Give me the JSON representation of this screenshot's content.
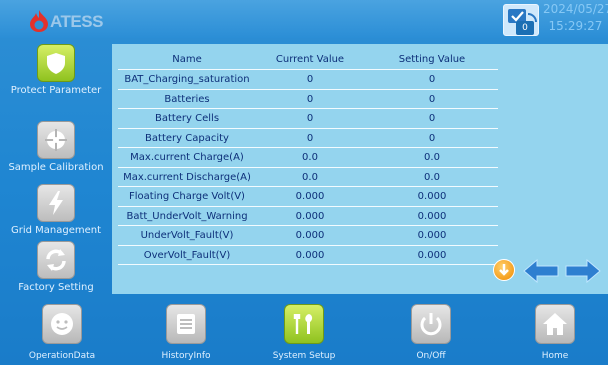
{
  "header": {
    "logo_text": "ATESS",
    "status_count": "0",
    "date": "2024/05/27",
    "time": "15:29:27"
  },
  "sidebar": {
    "items": [
      {
        "label": "Protect Parameter",
        "icon": "shield-icon",
        "active": true
      },
      {
        "label": "Sample Calibration",
        "icon": "crosshair-icon",
        "active": false
      },
      {
        "label": "Grid Management",
        "icon": "lightning-icon",
        "active": false
      },
      {
        "label": "Factory Setting",
        "icon": "refresh-icon",
        "active": false
      }
    ]
  },
  "table": {
    "headers": {
      "name": "Name",
      "current": "Current Value",
      "setting": "Setting Value"
    },
    "rows": [
      {
        "name": "BAT_Charging_saturation",
        "current": "0",
        "setting": "0"
      },
      {
        "name": "Batteries",
        "current": "0",
        "setting": "0"
      },
      {
        "name": "Battery Cells",
        "current": "0",
        "setting": "0"
      },
      {
        "name": "Battery Capacity",
        "current": "0",
        "setting": "0"
      },
      {
        "name": "Max.current Charge(A)",
        "current": "0.0",
        "setting": "0.0"
      },
      {
        "name": "Max.current Discharge(A)",
        "current": "0.0",
        "setting": "0.0"
      },
      {
        "name": "Floating Charge Volt(V)",
        "current": "0.000",
        "setting": "0.000"
      },
      {
        "name": "Batt_UnderVolt_Warning",
        "current": "0.000",
        "setting": "0.000"
      },
      {
        "name": "UnderVolt_Fault(V)",
        "current": "0.000",
        "setting": "0.000"
      },
      {
        "name": "OverVolt_Fault(V)",
        "current": "0.000",
        "setting": "0.000"
      }
    ]
  },
  "navigation": {
    "down_icon": "arrow-down-circle-icon",
    "prev_icon": "arrow-left-icon",
    "next_icon": "arrow-right-icon"
  },
  "bottom_nav": {
    "items": [
      {
        "label": "OperationData",
        "icon": "smiley-icon",
        "active": false
      },
      {
        "label": "HistoryInfo",
        "icon": "list-icon",
        "active": false
      },
      {
        "label": "System Setup",
        "icon": "tools-icon",
        "active": true
      },
      {
        "label": "On/Off",
        "icon": "power-icon",
        "active": false
      },
      {
        "label": "Home",
        "icon": "home-icon",
        "active": false
      }
    ]
  },
  "colors": {
    "background": "#1f86d2",
    "panel": "#94d4ee",
    "table_text": "#0d2f79",
    "active_tile": "#8fc21f",
    "logo_flame": "#e3312b",
    "nav_arrow": "#2e7fd0",
    "down_button": "#f08a00"
  }
}
